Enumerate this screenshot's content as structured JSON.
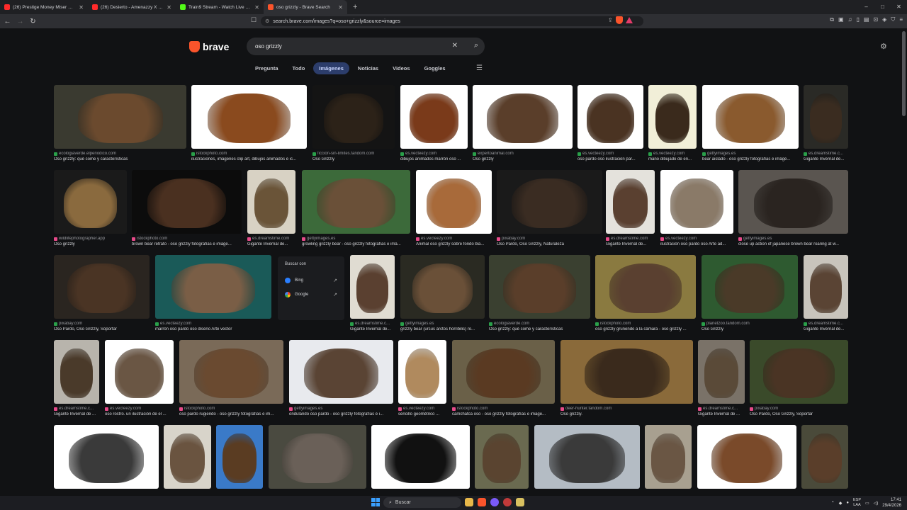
{
  "tabs": [
    {
      "title": "(26) Prestige Money Miser Mordekai...",
      "color": "#ff2a2a"
    },
    {
      "title": "(26) Desierto - Amenazzy X Don...",
      "color": "#ff2a2a"
    },
    {
      "title": "Train9 Stream - Watch Live on Kick",
      "color": "#53fc18"
    },
    {
      "title": "oso grizzly - Brave Search",
      "color": "#fb542b"
    }
  ],
  "window_controls": {
    "minimize": "–",
    "maximize": "□",
    "close": "✕"
  },
  "toolbar": {
    "url": "search.brave.com/images?q=oso+grizzly&source=images",
    "bookmark_icon": "bookmark-icon"
  },
  "logo": {
    "text": "brave"
  },
  "search": {
    "query": "oso grizzly"
  },
  "search_tabs": [
    "Pregunta",
    "Todo",
    "Imágenes",
    "Noticias",
    "Videos",
    "Goggles"
  ],
  "active_tab": "Imágenes",
  "context_menu": {
    "title": "Buscar con",
    "items": [
      "Bing",
      "Google"
    ]
  },
  "rows": [
    [
      {
        "src": "ecologiaverde.elperiodico.com",
        "cap": "Oso grizzly: qué come y características",
        "c": "#6b4a2e",
        "bg": "#3a3a30"
      },
      {
        "src": "istockphoto.com",
        "cap": "ilustraciones, imágenes clip art, dibujos animados e ic...",
        "c": "#8a4a1e",
        "bg": "#ffffff"
      },
      {
        "src": "ficcion-sin-limites.fandom.com",
        "cap": "Oso Grizzly",
        "c": "#2c2218",
        "bg": "#141414"
      },
      {
        "src": "es.vecteezy.com",
        "cap": "dibujos animados marrón oso ...",
        "c": "#7a3a1a",
        "bg": "#ffffff"
      },
      {
        "src": "expertoanimal.com",
        "cap": "Oso grizzly",
        "c": "#5a3e2a",
        "bg": "#ffffff"
      },
      {
        "src": "es.vecteezy.com",
        "cap": "oso pardo oso ilustración par...",
        "c": "#4a3322",
        "bg": "#ffffff"
      },
      {
        "src": "es.vecteezy.com",
        "cap": "mano dibujado de en...",
        "c": "#3a2a1c",
        "bg": "#f1efd8"
      },
      {
        "src": "gettyimages.es",
        "cap": "bear aislado - oso grizzly fotografías e imáge...",
        "c": "#8a5a2e",
        "bg": "#ffffff"
      },
      {
        "src": "es.dreamstime.c...",
        "cap": "Gigante Invernal de...",
        "c": "#3a2c20",
        "bg": "#2a2a26"
      }
    ],
    [
      {
        "src": "wildlifephotographer.app",
        "cap": "Oso grizzly",
        "c": "#8a6a3e",
        "bg": "#1a1a1a"
      },
      {
        "src": "istockphoto.com",
        "cap": "brown bear retrato - oso grizzly fotografías e imáge...",
        "c": "#4a3020",
        "bg": "#0c0c0c"
      },
      {
        "src": "es.dreamstime.com",
        "cap": "Gigante Invernal de...",
        "c": "#6a5438",
        "bg": "#d8d2c4"
      },
      {
        "src": "gettyimages.es",
        "cap": "growling grizzly bear - oso grizzly fotografías e imá...",
        "c": "#6a5038",
        "bg": "#3c6a3a"
      },
      {
        "src": "es.vecteezy.com",
        "cap": "Animal oso grizzly sobre fondo bla...",
        "c": "#a86a3a",
        "bg": "#ffffff"
      },
      {
        "src": "pixabay.com",
        "cap": "Oso Pardo, Oso Grizzly, Naturaleza",
        "c": "#3a2c22",
        "bg": "#1a1a1a"
      },
      {
        "src": "es.dreamstime.com",
        "cap": "Gigante Invernal de...",
        "c": "#5a4030",
        "bg": "#e4e2dc"
      },
      {
        "src": "es.vecteezy.com",
        "cap": "ilustración oso pardo oso Arte ad...",
        "c": "#8a7a68",
        "bg": "#ffffff"
      },
      {
        "src": "gettyimages.es",
        "cap": "close up action of japanese brown bear roaring at w...",
        "c": "#2a2420",
        "bg": "#5a5550"
      }
    ],
    [
      {
        "src": "pixabay.com",
        "cap": "Oso Pardo, Oso Grizzly, Soportar",
        "c": "#4a3424",
        "bg": "#2a2520"
      },
      {
        "src": "es.vecteezy.com",
        "cap": "marrón oso pardo oso diseño Arte vector",
        "c": "#7a5e46",
        "bg": "#1a5a58"
      },
      {
        "src": "es.dreamstime.c...",
        "cap": "Gigante Invernal de...",
        "c": "#5a4030",
        "bg": "#e0dcd2"
      },
      {
        "src": "gettyimages.es",
        "cap": "grizzly bear (ursus arctos horribilis) ro...",
        "c": "#6a5038",
        "bg": "#2a2a22"
      },
      {
        "src": "ecologiaverde.com",
        "cap": "Oso grizzly: qué come y características",
        "c": "#5a3e2a",
        "bg": "#3a4030"
      },
      {
        "src": "istockphoto.com",
        "cap": "oso grizzly gruñendo a la cámara - oso grizzly ...",
        "c": "#5a4030",
        "bg": "#8a7a40"
      },
      {
        "src": "planetzoo.fandom.com",
        "cap": "Oso Grizzly",
        "c": "#4a3a28",
        "bg": "#2e5a30"
      },
      {
        "src": "es.dreamstime.c...",
        "cap": "Gigante Invernal de...",
        "c": "#5a4434",
        "bg": "#c8c4bc"
      }
    ],
    [
      {
        "src": "es.dreamstime.c...",
        "cap": "Gigante Invernal de ...",
        "c": "#4a3a2a",
        "bg": "#b8b4ac"
      },
      {
        "src": "es.vecteezy.com",
        "cap": "oso rostro. un ilustración de el ...",
        "c": "#6a5644",
        "bg": "#ffffff"
      },
      {
        "src": "istockphoto.com",
        "cap": "oso pardo rugiendo - oso grizzly fotografías e im...",
        "c": "#6a4a30",
        "bg": "#7a6a58"
      },
      {
        "src": "gettyimages.es",
        "cap": "ondulando oso pardo - oso grizzly fotografías e i...",
        "c": "#5a4434",
        "bg": "#e8eaee"
      },
      {
        "src": "es.vecteezy.com",
        "cap": "sencillo geométrico ...",
        "c": "#b08a5e",
        "bg": "#ffffff"
      },
      {
        "src": "istockphoto.com",
        "cap": "camchatca oso - oso grizzly fotografías e imáge...",
        "c": "#5a3a22",
        "bg": "#6a6048"
      },
      {
        "src": "deer-hunter.fandom.com",
        "cap": "Oso grizzly.",
        "c": "#3a2a1c",
        "bg": "#8a6a3a"
      },
      {
        "src": "es.dreamstime.c...",
        "cap": "Gigante Invernal de ...",
        "c": "#5a4a38",
        "bg": "#7a7268"
      },
      {
        "src": "pixabay.com",
        "cap": "Oso Pardo, Oso Grizzly, Soportar",
        "c": "#4a3424",
        "bg": "#3a4a2a"
      }
    ],
    [
      {
        "src": "",
        "cap": "",
        "c": "#3a3a3a",
        "bg": "#ffffff"
      },
      {
        "src": "",
        "cap": "",
        "c": "#6a5440",
        "bg": "#d8d4ca"
      },
      {
        "src": "",
        "cap": "",
        "c": "#5a3c22",
        "bg": "#3a7ac8"
      },
      {
        "src": "",
        "cap": "",
        "c": "#6a6058",
        "bg": "#4a4a40"
      },
      {
        "src": "",
        "cap": "",
        "c": "#111111",
        "bg": "#ffffff"
      },
      {
        "src": "",
        "cap": "",
        "c": "#5a4430",
        "bg": "#6a6a50"
      },
      {
        "src": "",
        "cap": "",
        "c": "#3a3a3a",
        "bg": "#b4bcc4"
      },
      {
        "src": "",
        "cap": "",
        "c": "#6a5644",
        "bg": "#a8a090"
      },
      {
        "src": "",
        "cap": "",
        "c": "#7a4a2a",
        "bg": "#ffffff"
      },
      {
        "src": "",
        "cap": "",
        "c": "#5a3e2a",
        "bg": "#4a4a3a"
      }
    ]
  ],
  "taskbar": {
    "search_placeholder": "Buscar",
    "lang_top": "ESP",
    "lang_bottom": "LAA",
    "time": "17:41",
    "date": "29/4/2026"
  }
}
